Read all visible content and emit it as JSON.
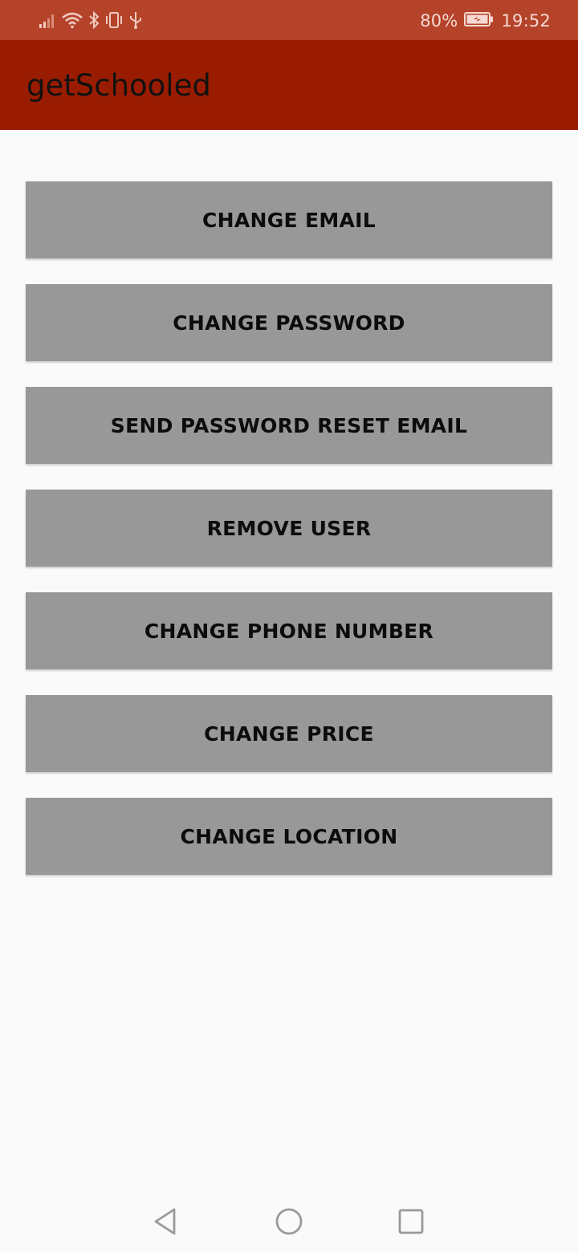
{
  "status_bar": {
    "battery_percent": "80%",
    "time": "19:52",
    "icons": [
      "signal-icon",
      "wifi-icon",
      "bluetooth-icon",
      "vibrate-icon",
      "usb-icon",
      "battery-charging-icon"
    ]
  },
  "app_bar": {
    "title": "getSchooled",
    "color": "#9a1c00"
  },
  "buttons": [
    {
      "label": "CHANGE EMAIL"
    },
    {
      "label": "CHANGE PASSWORD"
    },
    {
      "label": "SEND PASSWORD RESET EMAIL"
    },
    {
      "label": "REMOVE USER"
    },
    {
      "label": "CHANGE PHONE NUMBER"
    },
    {
      "label": "CHANGE PRICE"
    },
    {
      "label": "CHANGE LOCATION"
    }
  ],
  "nav_bar": {
    "icons": [
      "back-icon",
      "home-icon",
      "recents-icon"
    ]
  }
}
